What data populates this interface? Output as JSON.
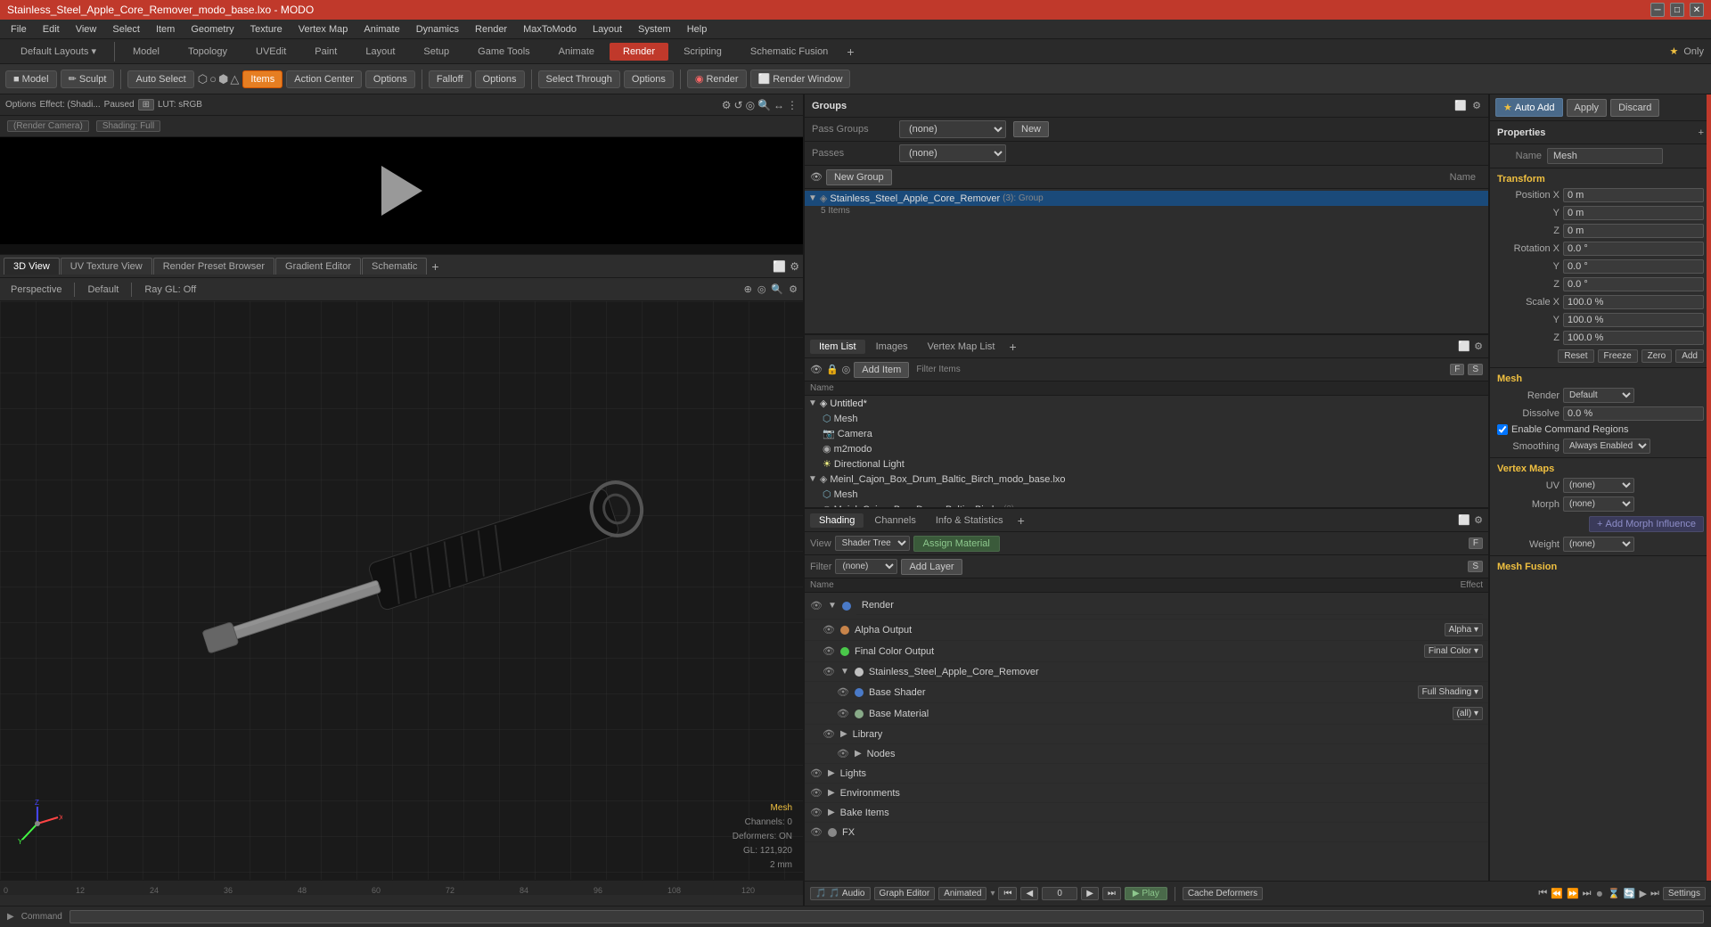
{
  "window": {
    "title": "Stainless_Steel_Apple_Core_Remover_modo_base.lxo - MODO"
  },
  "menu": {
    "items": [
      "File",
      "Edit",
      "View",
      "Select",
      "Item",
      "Geometry",
      "Texture",
      "Vertex Map",
      "Animate",
      "Dynamics",
      "Render",
      "MaxToModo",
      "Layout",
      "System",
      "Help"
    ]
  },
  "mode_tabs": {
    "items": [
      "Model",
      "Topology",
      "UVEdit",
      "Paint",
      "Layout",
      "Setup",
      "Game Tools",
      "Animate",
      "Render",
      "Scripting",
      "Schematic Fusion"
    ],
    "active": "Render",
    "star": "★",
    "only_label": "Only",
    "plus": "+"
  },
  "toolbar": {
    "model_btn": "Model",
    "sculpt_btn": "✏ Sculpt",
    "auto_select_btn": "Auto Select",
    "items_btn": "Items",
    "action_center_btn": "Action Center",
    "options_btn1": "Options",
    "falloff_btn": "Falloff",
    "options_btn2": "Options",
    "select_through_btn": "Select Through",
    "options_btn3": "Options",
    "render_btn": "Render",
    "render_window_btn": "Render Window"
  },
  "render_preview": {
    "options_label": "Options",
    "effect_label": "Effect: (Shadi...",
    "paused_label": "Paused",
    "lut_label": "LUT: sRGB",
    "render_camera_label": "(Render Camera)",
    "shading_label": "Shading: Full",
    "icons": [
      "⚙",
      "↺",
      "⊙",
      "🔍",
      "↔",
      "⚙"
    ]
  },
  "view_tabs": {
    "tabs": [
      "3D View",
      "UV Texture View",
      "Render Preset Browser",
      "Gradient Editor",
      "Schematic"
    ],
    "active": "3D View",
    "plus": "+"
  },
  "viewport": {
    "perspective_label": "Perspective",
    "default_label": "Default",
    "ray_gl_label": "Ray GL: Off",
    "mesh_label": "Mesh",
    "channels_label": "Channels: 0",
    "deformers_label": "Deformers: ON",
    "gl_label": "GL: 121,920",
    "size_label": "2 mm"
  },
  "groups_panel": {
    "title": "Groups",
    "pass_groups_label": "Pass Groups",
    "passes_label": "Passes",
    "none_label": "(none)",
    "new_btn": "New",
    "new_group_btn": "New Group",
    "tree_header": "Name",
    "group_name": "Stainless_Steel_Apple_Core_Remover",
    "group_type": "(3): Group",
    "group_items": "5 Items"
  },
  "items_panel": {
    "tabs": [
      "Item List",
      "Images",
      "Vertex Map List"
    ],
    "active": "Item List",
    "add_item_btn": "Add Item",
    "filter_items_label": "Filter Items",
    "column_name": "Name",
    "items": [
      {
        "name": "Untitled*",
        "type": "scene",
        "indent": 0
      },
      {
        "name": "Mesh",
        "type": "mesh",
        "indent": 1
      },
      {
        "name": "Camera",
        "type": "camera",
        "indent": 1
      },
      {
        "name": "m2modo",
        "type": "script",
        "indent": 1
      },
      {
        "name": "Directional Light",
        "type": "light",
        "indent": 1
      },
      {
        "name": "Meinl_Cajon_Box_Drum_Baltic_Birch_modo_base.lxo",
        "type": "scene",
        "indent": 0
      },
      {
        "name": "Mesh",
        "type": "mesh",
        "indent": 1
      },
      {
        "name": "Meinl_Cajon_Box_Drum_Baltic_Birch",
        "type": "item",
        "indent": 1
      }
    ]
  },
  "shading_panel": {
    "tabs": [
      "Shading",
      "Channels",
      "Info & Statistics"
    ],
    "active": "Shading",
    "view_label": "View",
    "shader_tree_label": "Shader Tree",
    "assign_material_btn": "Assign Material",
    "filter_label": "Filter",
    "none_label": "(none)",
    "add_layer_btn": "Add Layer",
    "col_name": "Name",
    "col_effect": "Effect",
    "items": [
      {
        "name": "Render",
        "type": "render",
        "indent": 0,
        "effect": ""
      },
      {
        "name": "Alpha Output",
        "type": "output",
        "indent": 1,
        "effect": "Alpha"
      },
      {
        "name": "Final Color Output",
        "type": "output",
        "indent": 1,
        "effect": "Final Color"
      },
      {
        "name": "Stainless_Steel_Apple_Core_Remover",
        "type": "material",
        "indent": 1,
        "effect": ""
      },
      {
        "name": "Base Shader",
        "type": "shader",
        "indent": 2,
        "effect": "Full Shading"
      },
      {
        "name": "Base Material",
        "type": "material",
        "indent": 2,
        "effect": "(all)"
      },
      {
        "name": "Library",
        "type": "folder",
        "indent": 1,
        "effect": ""
      },
      {
        "name": "Nodes",
        "type": "folder",
        "indent": 2,
        "effect": ""
      },
      {
        "name": "Lights",
        "type": "folder",
        "indent": 0,
        "effect": ""
      },
      {
        "name": "Environments",
        "type": "folder",
        "indent": 0,
        "effect": ""
      },
      {
        "name": "Bake Items",
        "type": "folder",
        "indent": 0,
        "effect": ""
      },
      {
        "name": "FX",
        "type": "folder",
        "indent": 0,
        "effect": ""
      }
    ]
  },
  "properties": {
    "title": "Properties",
    "auto_add_btn": "Auto Add",
    "apply_btn": "Apply",
    "discard_btn": "Discard",
    "name_label": "Name",
    "name_value": "Mesh",
    "transform_title": "Transform",
    "position_x": "0 m",
    "position_y": "0 m",
    "position_z": "0 m",
    "rotation_x": "0.0 °",
    "rotation_y": "0.0 °",
    "rotation_z": "0.0 °",
    "scale_x": "100.0 %",
    "scale_y": "100.0 %",
    "scale_z": "100.0 %",
    "reset_btn": "Reset",
    "freeze_btn": "Freeze",
    "zero_btn": "Zero",
    "add_btn": "Add",
    "mesh_title": "Mesh",
    "render_label": "Render",
    "render_value": "Default",
    "dissolve_label": "Dissolve",
    "dissolve_value": "0.0 %",
    "enable_cmd_regions": "Enable Command Regions",
    "smoothing_label": "Smoothing",
    "smoothing_value": "Always Enabled",
    "vertex_maps_title": "Vertex Maps",
    "uv_label": "UV",
    "uv_value": "(none)",
    "morph_label": "Morph",
    "morph_value": "(none)",
    "add_morph_btn": "Add Morph Influence",
    "weight_label": "Weight",
    "weight_value": "(none)",
    "mesh_fusion_title": "Mesh Fusion"
  },
  "timeline": {
    "audio_btn": "🎵 Audio",
    "graph_editor_btn": "Graph Editor",
    "animated_btn": "Animated",
    "cache_deformers_btn": "Cache Deformers",
    "settings_btn": "Settings",
    "play_btn": "▶ Play",
    "frame_value": "0",
    "ruler_ticks": [
      "0",
      "12",
      "24",
      "36",
      "48",
      "60",
      "72",
      "84",
      "96",
      "108",
      "120"
    ]
  },
  "status_bar": {
    "command_label": "Command"
  }
}
